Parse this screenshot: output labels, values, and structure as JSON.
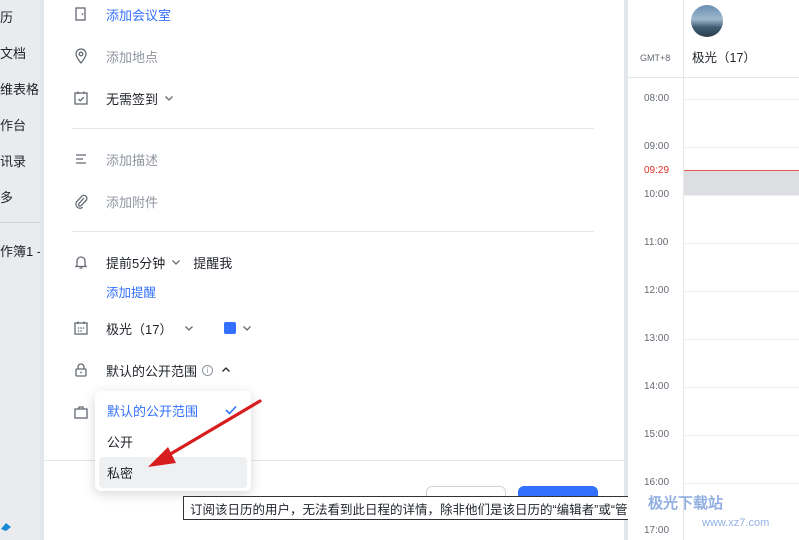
{
  "sidebar": {
    "items": [
      "历",
      "文档",
      "维表格",
      "作台",
      "讯录",
      "多"
    ],
    "bottom_item": "作簿1 -"
  },
  "form": {
    "add_room": "添加会议室",
    "add_location": "添加地点",
    "checkin": "无需签到",
    "add_description": "添加描述",
    "add_attachment": "添加附件",
    "reminder_time": "提前5分钟",
    "reminder_target": "提醒我",
    "add_reminder": "添加提醒",
    "calendar": "极光（17）",
    "calendar_color": "#3370ff",
    "visibility": "默认的公开范围"
  },
  "dropdown": {
    "options": [
      "默认的公开范围",
      "公开",
      "私密"
    ],
    "selected": "默认的公开范围",
    "hovered": "私密"
  },
  "tooltip": "订阅该日历的用户，无法看到此日程的详情，除非他们是该日历的“编辑者”或“管理员”。",
  "calendar_panel": {
    "timezone": "GMT+8",
    "user_name": "极光（17）",
    "current_time": "09:29",
    "hours": [
      "08:00",
      "09:00",
      "10:00",
      "11:00",
      "12:00",
      "13:00",
      "14:00",
      "15:00",
      "16:00",
      "17:00"
    ]
  },
  "watermark": {
    "title": "极光下载站",
    "url": "www.xz7.com"
  }
}
